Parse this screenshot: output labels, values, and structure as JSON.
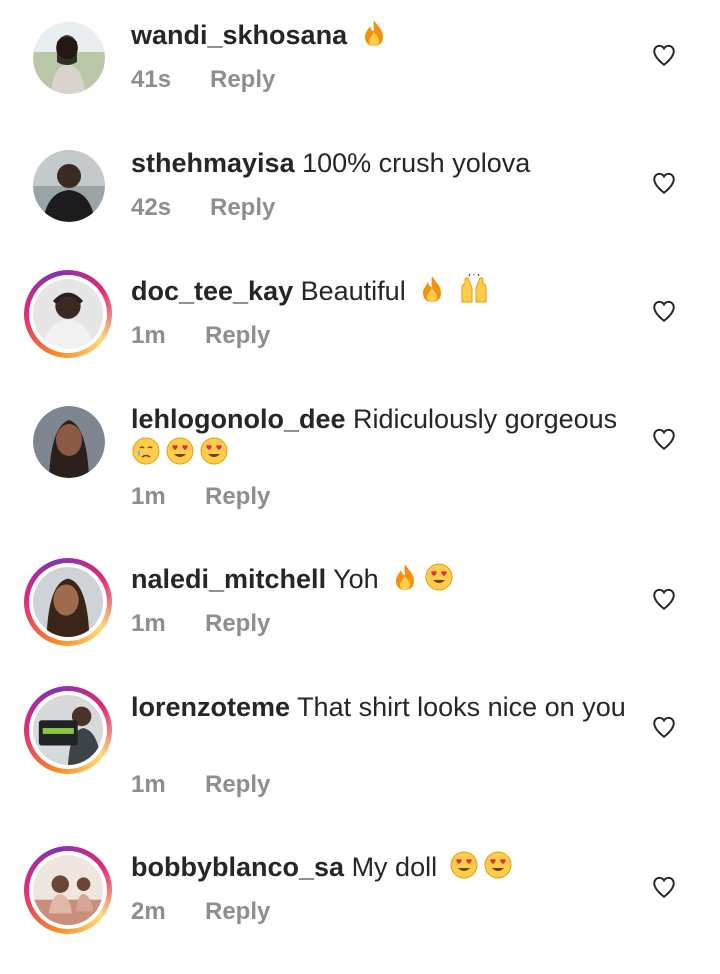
{
  "comments": [
    {
      "username": "wandi_skhosana",
      "text": "",
      "emojis": [
        "fire"
      ],
      "time": "41s",
      "reply": "Reply",
      "story_ring": false
    },
    {
      "username": "sthehmayisa",
      "text": "100% crush yolova",
      "emojis": [],
      "time": "42s",
      "reply": "Reply",
      "story_ring": false
    },
    {
      "username": "doc_tee_kay",
      "text": "Beautiful",
      "emojis": [
        "fire",
        "raising-hands"
      ],
      "time": "1m",
      "reply": "Reply",
      "story_ring": true
    },
    {
      "username": "lehlogonolo_dee",
      "text": "Ridiculously gorgeous",
      "emojis": [
        "crying-face",
        "heart-eyes",
        "heart-eyes"
      ],
      "time": "1m",
      "reply": "Reply",
      "story_ring": false
    },
    {
      "username": "naledi_mitchell",
      "text": "Yoh",
      "emojis": [
        "fire",
        "heart-eyes"
      ],
      "time": "1m",
      "reply": "Reply",
      "story_ring": true
    },
    {
      "username": "lorenzoteme",
      "text": "That shirt looks nice on you",
      "emojis": [],
      "time": "1m",
      "reply": "Reply",
      "story_ring": true
    },
    {
      "username": "bobbyblanco_sa",
      "text": "My doll",
      "emojis": [
        "heart-eyes",
        "heart-eyes"
      ],
      "time": "2m",
      "reply": "Reply",
      "story_ring": true
    }
  ],
  "icons": {
    "like": "heart-outline-icon"
  },
  "colors": {
    "username": "#262626",
    "meta": "#8e8e8e",
    "heart": "#262626"
  }
}
